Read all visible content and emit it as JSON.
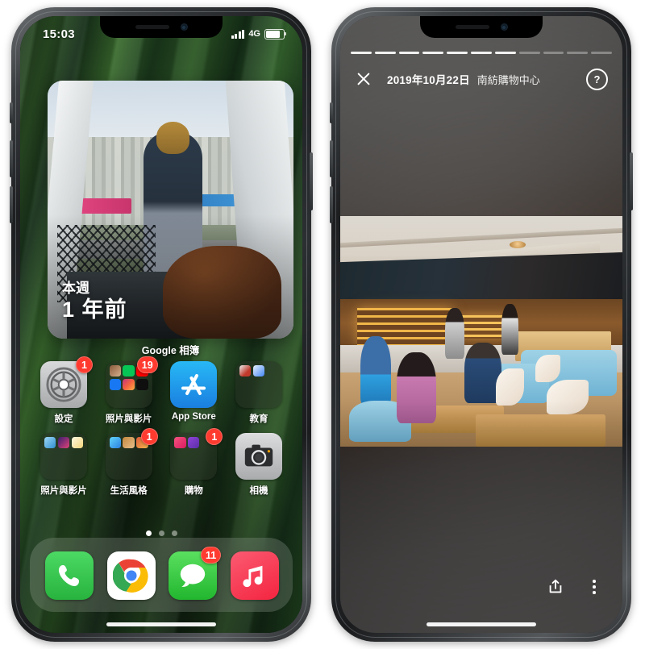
{
  "left_phone": {
    "status_bar": {
      "time": "15:03",
      "network": "4G",
      "signal_icon": "signal-bars-icon",
      "battery_icon": "battery-icon"
    },
    "widget": {
      "name": "google-photos-memories-widget",
      "line1": "本週",
      "line2": "1 年前",
      "app_label": "Google 相簿"
    },
    "apps": {
      "row1": [
        {
          "label": "設定",
          "icon": "settings-gear-icon",
          "badge": "1",
          "type": "app"
        },
        {
          "label": "照片與影片",
          "icon": "folder-icon",
          "badge": "19",
          "type": "folder"
        },
        {
          "label": "App Store",
          "icon": "app-store-icon",
          "badge": "",
          "type": "app"
        },
        {
          "label": "教育",
          "icon": "folder-icon",
          "badge": "",
          "type": "folder"
        }
      ],
      "row2": [
        {
          "label": "照片與影片",
          "icon": "folder-icon",
          "badge": "",
          "type": "folder"
        },
        {
          "label": "生活風格",
          "icon": "folder-icon",
          "badge": "1",
          "type": "folder"
        },
        {
          "label": "購物",
          "icon": "folder-icon",
          "badge": "1",
          "type": "folder"
        },
        {
          "label": "相機",
          "icon": "camera-icon",
          "badge": "",
          "type": "app"
        }
      ]
    },
    "page_dots": {
      "total": 3,
      "active_index": 0
    },
    "dock": [
      {
        "label": "Phone",
        "icon": "phone-icon",
        "badge": ""
      },
      {
        "label": "Chrome",
        "icon": "chrome-icon",
        "badge": ""
      },
      {
        "label": "Messages",
        "icon": "messages-icon",
        "badge": "11"
      },
      {
        "label": "Music",
        "icon": "music-note-icon",
        "badge": ""
      }
    ]
  },
  "right_phone": {
    "story": {
      "progress_total": 11,
      "progress_done": 7,
      "close_icon": "close-icon",
      "date": "2019年10月22日",
      "place": "南紡購物中心",
      "help_icon": "help-question-icon",
      "help_glyph": "?",
      "share_icon": "share-icon",
      "more_icon": "more-vertical-icon"
    }
  },
  "colors": {
    "badge_red": "#ff3b30",
    "app_store_blue": "#1a7fe0",
    "dock_green": "#27b33d",
    "music_red": "#f4243f",
    "frame_dark": "#1c1e20"
  }
}
